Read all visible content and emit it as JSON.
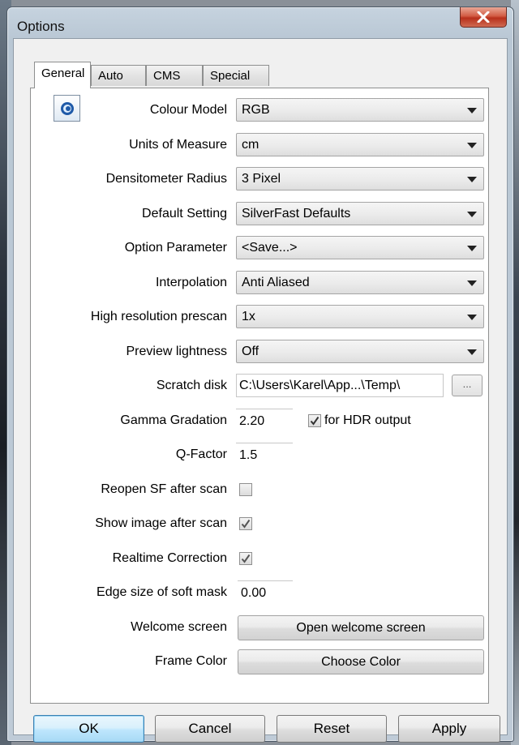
{
  "window": {
    "title": "Options",
    "close_glyph": "✕"
  },
  "tabs": [
    {
      "label": "General",
      "active": true
    },
    {
      "label": "Auto",
      "active": false
    },
    {
      "label": "CMS",
      "active": false
    },
    {
      "label": "Special",
      "active": false
    }
  ],
  "general": {
    "app_icon": "silverfast-icon",
    "colour_model": {
      "label": "Colour Model",
      "value": "RGB"
    },
    "units_of_measure": {
      "label": "Units of Measure",
      "value": "cm"
    },
    "densitometer_radius": {
      "label": "Densitometer Radius",
      "value": "3 Pixel"
    },
    "default_setting": {
      "label": "Default Setting",
      "value": "SilverFast Defaults"
    },
    "option_parameter": {
      "label": "Option Parameter",
      "value": "<Save...>"
    },
    "interpolation": {
      "label": "Interpolation",
      "value": "Anti Aliased"
    },
    "high_res_prescan": {
      "label": "High resolution prescan",
      "value": "1x"
    },
    "preview_lightness": {
      "label": "Preview lightness",
      "value": "Off"
    },
    "scratch_disk": {
      "label": "Scratch disk",
      "value": "C:\\Users\\Karel\\App...\\Temp\\",
      "browse_label": "..."
    },
    "gamma_gradation": {
      "label": "Gamma Gradation",
      "value": "2.20"
    },
    "hdr_output": {
      "label": "for HDR output",
      "checked": true
    },
    "q_factor": {
      "label": "Q-Factor",
      "value": "1.5"
    },
    "reopen_sf": {
      "label": "Reopen SF after scan",
      "checked": false
    },
    "show_image": {
      "label": "Show image after scan",
      "checked": true
    },
    "realtime_correction": {
      "label": "Realtime Correction",
      "checked": true
    },
    "edge_size": {
      "label": "Edge size of soft mask",
      "value": "0.00"
    },
    "welcome_screen": {
      "label": "Welcome screen",
      "button": "Open welcome screen"
    },
    "frame_color": {
      "label": "Frame Color",
      "button": "Choose Color"
    }
  },
  "footer": {
    "ok": "OK",
    "cancel": "Cancel",
    "reset": "Reset",
    "apply": "Apply"
  },
  "colors": {
    "accent_default_button": "#a7d9f5",
    "close_button": "#c8432b"
  }
}
